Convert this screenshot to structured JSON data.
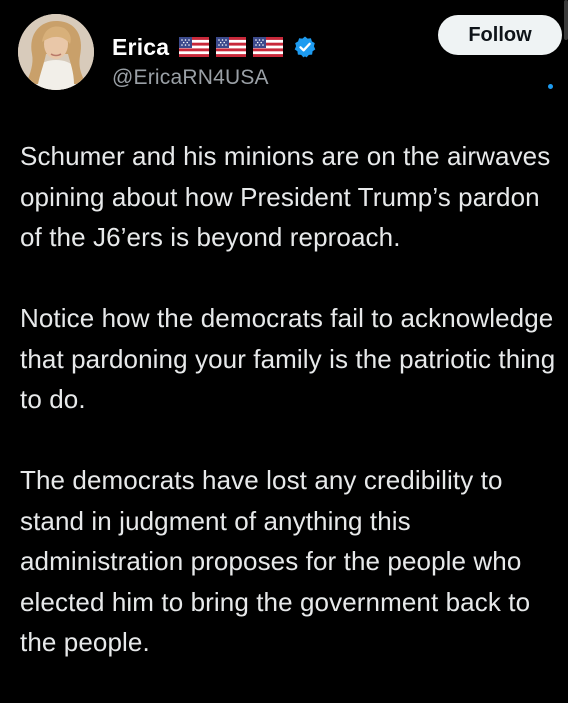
{
  "user": {
    "display_name": "Erica",
    "handle": "@EricaRN4USA",
    "flag_count": 3,
    "verified": true
  },
  "actions": {
    "follow_label": "Follow"
  },
  "post": {
    "paragraphs": [
      "Schumer and his minions are on the airwaves opining about how President Trump’s pardon of the J6’ers is beyond reproach.",
      "Notice how the democrats fail to acknowledge that pardoning your family is the patriotic thing to do.",
      "The democrats have lost any credibility to stand in judgment of anything this administration proposes for the people who elected him to bring the government back to the people."
    ]
  },
  "colors": {
    "background": "#000000",
    "text": "#e7e9ea",
    "secondary_text": "#9aa0a6",
    "verified_blue": "#1d9bf0",
    "follow_bg": "#eff3f4"
  },
  "icons": {
    "flag": "us-flag-icon",
    "verified": "verified-badge-icon"
  }
}
